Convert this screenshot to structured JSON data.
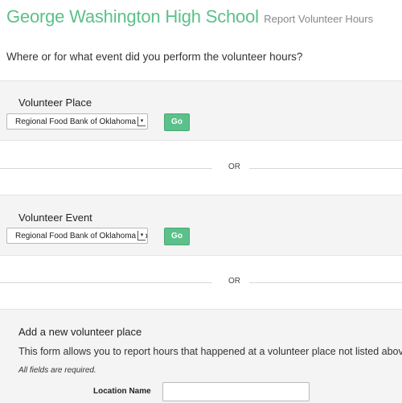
{
  "header": {
    "school_name": "George Washington High School",
    "page_title": "Report Volunteer Hours"
  },
  "question": "Where or for what event did you perform the volunteer hours?",
  "volunteer_place": {
    "label": "Volunteer Place",
    "selected": "Regional Food Bank of Oklahoma",
    "go_label": "Go"
  },
  "separator_text": "OR",
  "volunteer_event": {
    "label": "Volunteer Event",
    "selected": "Regional Food Bank of Oklahoma Vo",
    "go_label": "Go"
  },
  "new_place": {
    "title": "Add a new volunteer place",
    "description": "This form allows you to report hours that happened at a volunteer place not listed above.",
    "required_note": "All fields are required.",
    "location_label": "Location Name",
    "location_value": ""
  },
  "colors": {
    "accent": "#5cc08a",
    "section_bg": "#f4f4f4"
  }
}
